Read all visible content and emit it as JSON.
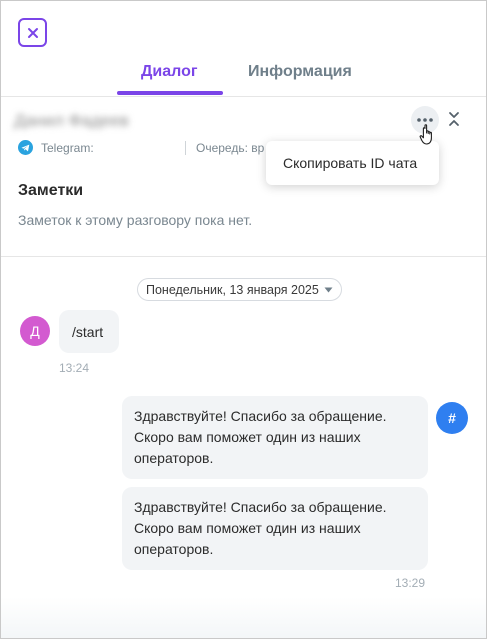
{
  "header": {
    "close_icon": "close-icon"
  },
  "tabs": [
    {
      "label": "Диалог",
      "active": true
    },
    {
      "label": "Информация",
      "active": false
    }
  ],
  "contact": {
    "name": "Данил Фадеев",
    "channel": "Telegram:",
    "queue": "Очередь: вр",
    "channel_icon": "telegram-icon"
  },
  "menu": {
    "items": [
      "Скопировать ID чата"
    ]
  },
  "notes": {
    "title": "Заметки",
    "empty": "Заметок к этому разговору пока нет."
  },
  "chat": {
    "date": "Понедельник, 13 января 2025",
    "incoming": {
      "avatar": "Д",
      "text": "/start",
      "time": "13:24"
    },
    "outgoing": {
      "avatar": "#",
      "messages": [
        "Здравствуйте! Спасибо за обращение.\nСкоро вам поможет один из наших\nоператоров.",
        "Здравствуйте! Спасибо за обращение.\nСкоро вам поможет один из наших\nоператоров."
      ],
      "time": "13:29"
    }
  },
  "colors": {
    "accent": "#7b45e8",
    "telegram": "#2aa3df",
    "user_avatar": "#d35ad0",
    "bot_avatar": "#2f7ff0"
  }
}
